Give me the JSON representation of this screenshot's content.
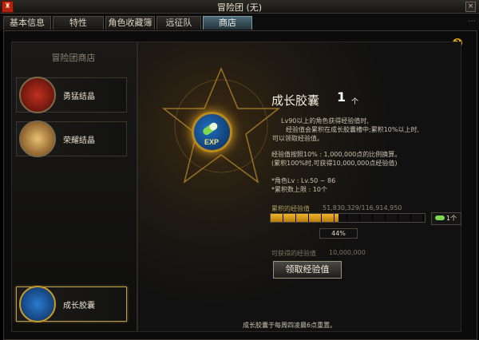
{
  "window": {
    "title": "冒险团 (无)"
  },
  "tabs": [
    {
      "label": "基本信息"
    },
    {
      "label": "特性"
    },
    {
      "label": "角色收藏簿"
    },
    {
      "label": "远征队"
    },
    {
      "label": "商店"
    }
  ],
  "deco_right": "…",
  "shop": {
    "title": "冒险团商店",
    "items": [
      {
        "label": "勇猛结晶",
        "icon": "red-crystal-icon"
      },
      {
        "label": "荣耀结晶",
        "icon": "trophy-icon"
      },
      {
        "label": "成长胶囊",
        "icon": "exp-capsule-icon"
      }
    ]
  },
  "detail": {
    "title": "成长胶囊",
    "count": "1",
    "count_unit": "个",
    "desc1": "Lv90以上的角色获得经验值时,",
    "desc2": "经验值会累积在成长胶囊槽中;累积10%以上时,",
    "desc3": "可以领取经验值。",
    "rate1": "经验值按照10% : 1,000,000点的比例换算。",
    "rate2": "(累积100%时,可获得10,000,000点经验值)",
    "level_label": "*角色Lv : Lv.50 ~ 86",
    "cap_label": "*累积数上限 : 10个",
    "accum_label": "累积的经验值",
    "accum_value": "51,830,329/116,914,950",
    "progress_percent": 44,
    "progress_text": "44%",
    "capsule_count": "1个",
    "obtainable_label": "可获得的经验值",
    "obtainable_value": "10,000,000",
    "claim_button": "领取经验值",
    "reset_note": "成长胶囊于每周四凌晨6点重置。"
  },
  "icon_text": "EXP",
  "colors": {
    "accent_gold": "#e6a52a",
    "progress": "#f0b428",
    "active_tab": "#4d6b78"
  }
}
